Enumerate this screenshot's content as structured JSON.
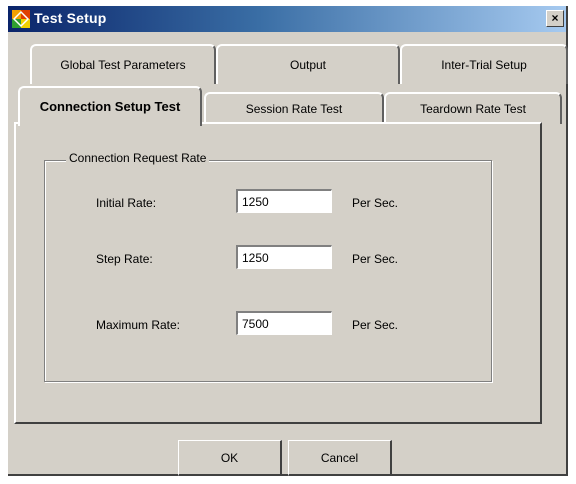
{
  "window": {
    "title": "Test Setup",
    "close_glyph": "×",
    "app_icon": "test-setup-app-icon"
  },
  "tabs": {
    "row_back": [
      {
        "label": "Global Test Parameters"
      },
      {
        "label": "Output"
      },
      {
        "label": "Inter-Trial Setup"
      }
    ],
    "row_front": [
      {
        "label": "Connection Setup Test",
        "active": true
      },
      {
        "label": "Session Rate Test"
      },
      {
        "label": "Teardown Rate Test"
      }
    ]
  },
  "group": {
    "title": "Connection Request Rate",
    "rows": [
      {
        "label": "Initial Rate:",
        "value": "1250",
        "unit": "Per Sec."
      },
      {
        "label": "Step Rate:",
        "value": "1250",
        "unit": "Per Sec."
      },
      {
        "label": "Maximum Rate:",
        "value": "7500",
        "unit": "Per Sec."
      }
    ]
  },
  "buttons": {
    "ok": "OK",
    "cancel": "Cancel"
  },
  "colors": {
    "dialog_bg": "#d4d0c8",
    "title_start": "#0a246a",
    "title_end": "#a6caf0"
  }
}
